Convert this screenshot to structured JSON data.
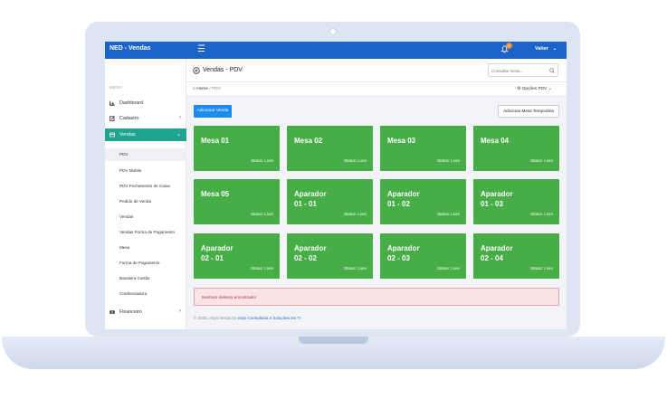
{
  "app": {
    "brand": "NED - Vendas",
    "notifications_count": "0",
    "user_name": "Valter",
    "user_caret": "⌄"
  },
  "sidebar": {
    "menu_caption": "MENU",
    "items": [
      {
        "label": "Dashboard",
        "icon": "chart-icon"
      },
      {
        "label": "Cadastro",
        "icon": "edit-icon",
        "chevron": "›"
      },
      {
        "label": "Vendas",
        "icon": "card-icon",
        "chevron": "⌄",
        "active": true
      },
      {
        "label": "Financeiro",
        "icon": "money-icon",
        "chevron": "›"
      }
    ],
    "subitems": [
      "PDV",
      "PDV Mobile",
      "PDV Fechamento de Caixa",
      "Pedido de Venda",
      "Vendas",
      "Vendas Forma de Pagamento",
      "Mesa",
      "Forma de Pagamento",
      "Bandeira Cartão",
      "Credenciadora"
    ]
  },
  "header": {
    "title": "Vendas - PDV",
    "search_placeholder": "Consultar mesa...",
    "breadcrumb_home": "Home",
    "breadcrumb_sep": "/",
    "breadcrumb_current": "PDV",
    "options_label": "Opções PDV ⌄"
  },
  "actions": {
    "add_sale": "Adicionar Venda",
    "add_temp_table": "Adicionar Mesa Temporária"
  },
  "tables": [
    {
      "line1": "Mesa 01",
      "line2": "",
      "status": "Status:  Livre"
    },
    {
      "line1": "Mesa 02",
      "line2": "",
      "status": "Status:  Livre"
    },
    {
      "line1": "Mesa 03",
      "line2": "",
      "status": "Status:  Livre"
    },
    {
      "line1": "Mesa 04",
      "line2": "",
      "status": "Status:  Livre"
    },
    {
      "line1": "Mesa 05",
      "line2": "",
      "status": "Status:  Livre"
    },
    {
      "line1": "Aparador",
      "line2": "01 - 01",
      "status": "Status:  Livre"
    },
    {
      "line1": "Aparador",
      "line2": "01 - 02",
      "status": "Status:  Livre"
    },
    {
      "line1": "Aparador",
      "line2": "01 - 03",
      "status": "Status:  Livre"
    },
    {
      "line1": "Aparador",
      "line2": "02 - 01",
      "status": "Status:  Livre"
    },
    {
      "line1": "Aparador",
      "line2": "02 - 02",
      "status": "Status:  Livre"
    },
    {
      "line1": "Aparador",
      "line2": "02 - 03",
      "status": "Status:  Livre"
    },
    {
      "line1": "Aparador",
      "line2": "02 - 04",
      "status": "Status:  Livre"
    }
  ],
  "alert": {
    "text": "Nenhum delivery encontrado!"
  },
  "footer": {
    "prefix": "© 2020, eSys Venda by ",
    "link": "eSys Consultoria e Soluções em TI"
  },
  "colors": {
    "topbar": "#1c63c8",
    "active": "#1fa490",
    "card": "#46ad47",
    "button": "#1c8cf0"
  }
}
